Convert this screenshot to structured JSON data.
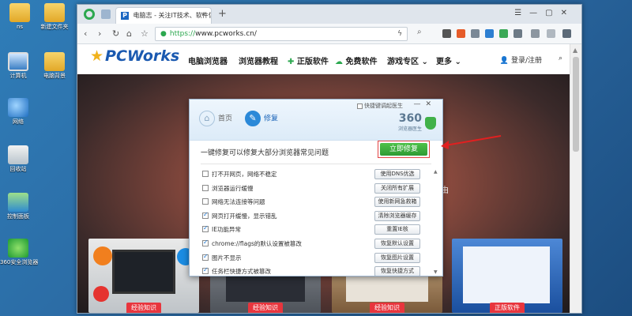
{
  "desktop": {
    "icons": [
      {
        "label": "ns",
        "icon": "folder-icon"
      },
      {
        "label": "新建文件夹",
        "icon": "folder-icon"
      },
      {
        "label": "计算机",
        "icon": "computer-icon"
      },
      {
        "label": "电脑背景",
        "icon": "folder-icon"
      },
      {
        "label": "网络",
        "icon": "network-icon"
      },
      {
        "label": "回收站",
        "icon": "recycle-bin-icon"
      },
      {
        "label": "控制面板",
        "icon": "control-panel-icon"
      },
      {
        "label": "360安全浏览器",
        "icon": "browser-360-icon"
      }
    ]
  },
  "browser": {
    "tab_title": "电脑志 - 关注IT技术、软件信息...",
    "tab_favicon": "P",
    "url_scheme": "https://",
    "url_rest": "www.pcworks.cn/",
    "accent": "#2ca84f"
  },
  "site": {
    "logo": "PCWorks",
    "nav": [
      "电脑浏览器",
      "浏览器教程",
      "正版软件",
      "免费软件",
      "游戏专区",
      "更多"
    ],
    "login": "登录/注册",
    "hero_text": "由",
    "thumb_tags": [
      "经验知识",
      "经验知识",
      "经验知识",
      "正版软件"
    ]
  },
  "dialog": {
    "tab_home": "首页",
    "tab_fix": "修复",
    "option_label": "快捷键调起医生",
    "brand_num": "360",
    "brand_sub": "浏览器医生",
    "description": "一键修复可以修复大部分浏览器常见问题",
    "fix_button": "立即修复",
    "rows": [
      {
        "text": "打不开网页，网络不稳定",
        "checked": false,
        "button": "使用DNS优选"
      },
      {
        "text": "浏览器运行缓慢",
        "checked": false,
        "button": "关闭所有扩展"
      },
      {
        "text": "网络无法连接等问题",
        "checked": false,
        "button": "使用新网急救箱"
      },
      {
        "text": "网页打开缓慢，显示错乱",
        "checked": true,
        "button": "清除浏览器缓存"
      },
      {
        "text": "IE功能异常",
        "checked": true,
        "button": "重置IE核"
      },
      {
        "text": "chrome://flags的默认设置被篡改",
        "checked": true,
        "button": "恢复默认设置"
      },
      {
        "text": "图片不显示",
        "checked": true,
        "button": "恢复图片设置"
      },
      {
        "text": "任务栏快捷方式被篡改",
        "checked": true,
        "button": "恢复快捷方式"
      }
    ]
  }
}
